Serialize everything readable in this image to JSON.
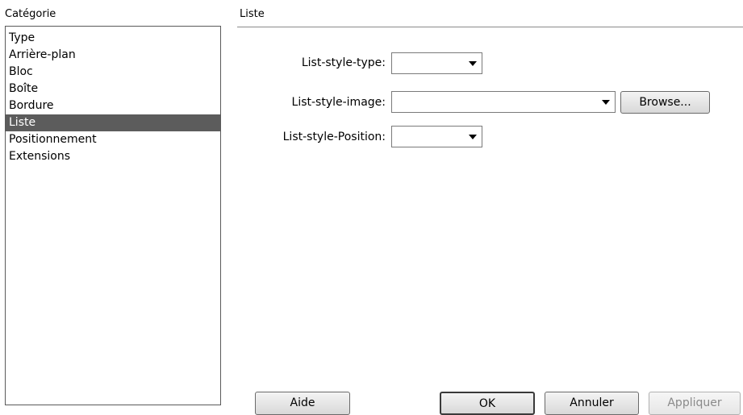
{
  "category_panel": {
    "heading": "Catégorie",
    "items": [
      {
        "label": "Type",
        "selected": false
      },
      {
        "label": "Arrière-plan",
        "selected": false
      },
      {
        "label": "Bloc",
        "selected": false
      },
      {
        "label": "Boîte",
        "selected": false
      },
      {
        "label": "Bordure",
        "selected": false
      },
      {
        "label": "Liste",
        "selected": true
      },
      {
        "label": "Positionnement",
        "selected": false
      },
      {
        "label": "Extensions",
        "selected": false
      }
    ]
  },
  "section": {
    "heading": "Liste",
    "fields": {
      "list_style_type": {
        "label": "List-style-type:",
        "value": ""
      },
      "list_style_image": {
        "label": "List-style-image:",
        "value": ""
      },
      "list_style_position": {
        "label": "List-style-Position:",
        "value": ""
      }
    },
    "browse_label": "Browse..."
  },
  "footer": {
    "help_label": "Aide",
    "ok_label": "OK",
    "cancel_label": "Annuler",
    "apply_label": "Appliquer"
  },
  "colors": {
    "selection_bg": "#5c5c5c",
    "selection_text": "#ffffff"
  },
  "icons": {
    "dropdown": "chevron-down-icon"
  }
}
